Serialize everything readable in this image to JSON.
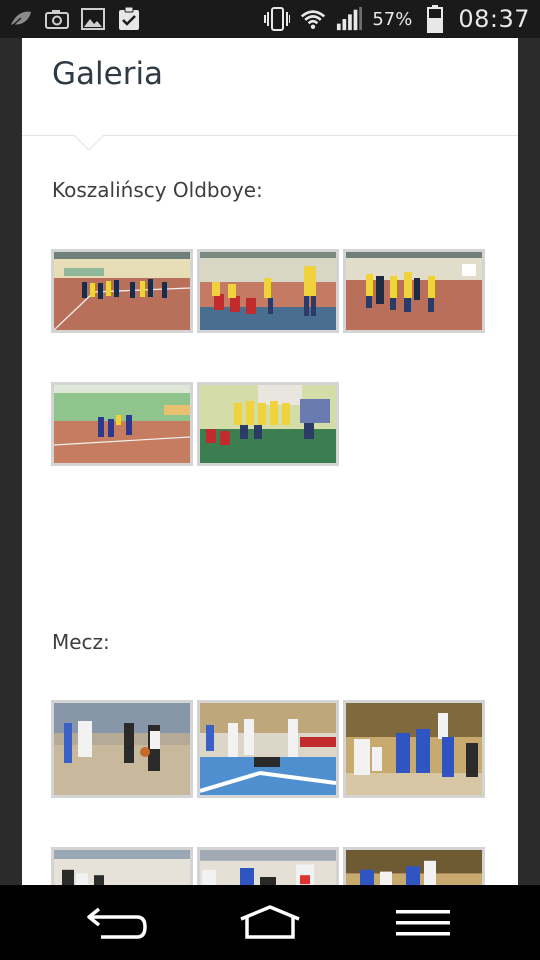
{
  "status_bar": {
    "battery_percent": "57%",
    "time": "08:37",
    "icons_left": [
      "leaf-icon",
      "camera-icon",
      "image-icon",
      "clipboard-check-icon"
    ],
    "icons_right": [
      "vibrate-icon",
      "wifi-icon",
      "signal-icon",
      "battery-icon"
    ]
  },
  "page": {
    "title": "Galeria"
  },
  "sections": [
    {
      "label": "Koszalińscy Oldboye:",
      "thumbnails": [
        "gym-court-wide",
        "players-bench-yellow",
        "players-yellow-standing",
        "court-green-wall",
        "team-photo-yellow"
      ]
    },
    {
      "label": "Mecz:",
      "thumbnails": [
        "game-dribble-referee",
        "game-player-fallen",
        "game-rebound-blue",
        "game-crowd-left",
        "game-jump-center",
        "game-arena-right"
      ]
    }
  ],
  "nav_bar": {
    "buttons": [
      "back-button",
      "home-button",
      "menu-button"
    ]
  }
}
